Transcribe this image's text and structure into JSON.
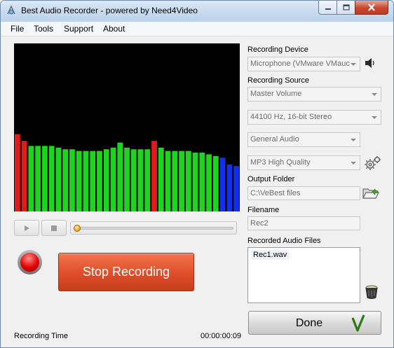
{
  "window": {
    "title": "Best Audio Recorder - powered by Need4Video"
  },
  "menu": [
    "File",
    "Tools",
    "Support",
    "About"
  ],
  "visualizer": {
    "level_bars": [
      {
        "level": 0.46,
        "color": "#e01b1b"
      },
      {
        "level": 0.42,
        "color": "#e01b1b"
      },
      {
        "level": 0.39,
        "color": "#1fd41f"
      },
      {
        "level": 0.39,
        "color": "#1fd41f"
      },
      {
        "level": 0.39,
        "color": "#1fd41f"
      },
      {
        "level": 0.39,
        "color": "#1fd41f"
      },
      {
        "level": 0.38,
        "color": "#1fd41f"
      },
      {
        "level": 0.37,
        "color": "#1fd41f"
      },
      {
        "level": 0.37,
        "color": "#1fd41f"
      },
      {
        "level": 0.36,
        "color": "#1fd41f"
      },
      {
        "level": 0.36,
        "color": "#1fd41f"
      },
      {
        "level": 0.36,
        "color": "#1fd41f"
      },
      {
        "level": 0.36,
        "color": "#1fd41f"
      },
      {
        "level": 0.37,
        "color": "#1fd41f"
      },
      {
        "level": 0.38,
        "color": "#1fd41f"
      },
      {
        "level": 0.41,
        "color": "#1fd41f"
      },
      {
        "level": 0.38,
        "color": "#1fd41f"
      },
      {
        "level": 0.37,
        "color": "#1fd41f"
      },
      {
        "level": 0.37,
        "color": "#1fd41f"
      },
      {
        "level": 0.37,
        "color": "#1fd41f"
      },
      {
        "level": 0.42,
        "color": "#e01b1b"
      },
      {
        "level": 0.38,
        "color": "#1fd41f"
      },
      {
        "level": 0.36,
        "color": "#1fd41f"
      },
      {
        "level": 0.36,
        "color": "#1fd41f"
      },
      {
        "level": 0.36,
        "color": "#1fd41f"
      },
      {
        "level": 0.36,
        "color": "#1fd41f"
      },
      {
        "level": 0.35,
        "color": "#1fd41f"
      },
      {
        "level": 0.35,
        "color": "#1fd41f"
      },
      {
        "level": 0.34,
        "color": "#1fd41f"
      },
      {
        "level": 0.33,
        "color": "#1fd41f"
      },
      {
        "level": 0.32,
        "color": "#1430e6"
      },
      {
        "level": 0.28,
        "color": "#1430e6"
      },
      {
        "level": 0.27,
        "color": "#1430e6"
      }
    ]
  },
  "player": {
    "play_icon": "play-icon",
    "stop_icon": "stop-icon",
    "seek_position": 0.0
  },
  "record": {
    "stop_label": "Stop Recording",
    "time_label": "Recording Time",
    "time_value": "00:00:00:09"
  },
  "settings": {
    "device_label": "Recording Device",
    "device_value": "Microphone (VMware VMauc",
    "source_label": "Recording Source",
    "source_value": "Master Volume",
    "format_value": "44100 Hz, 16-bit Stereo",
    "profile_value": "General Audio",
    "quality_value": "MP3 High Quality",
    "output_label": "Output Folder",
    "output_value": "C:\\VeBest files",
    "filename_label": "Filename",
    "filename_value": "Rec2",
    "files_label": "Recorded Audio Files",
    "files": [
      "Rec1.wav"
    ]
  },
  "done": {
    "label": "Done"
  },
  "colors": {
    "accent_red": "#e0502c",
    "bar_green": "#1fd41f",
    "bar_red": "#e01b1b",
    "bar_blue": "#1430e6"
  }
}
